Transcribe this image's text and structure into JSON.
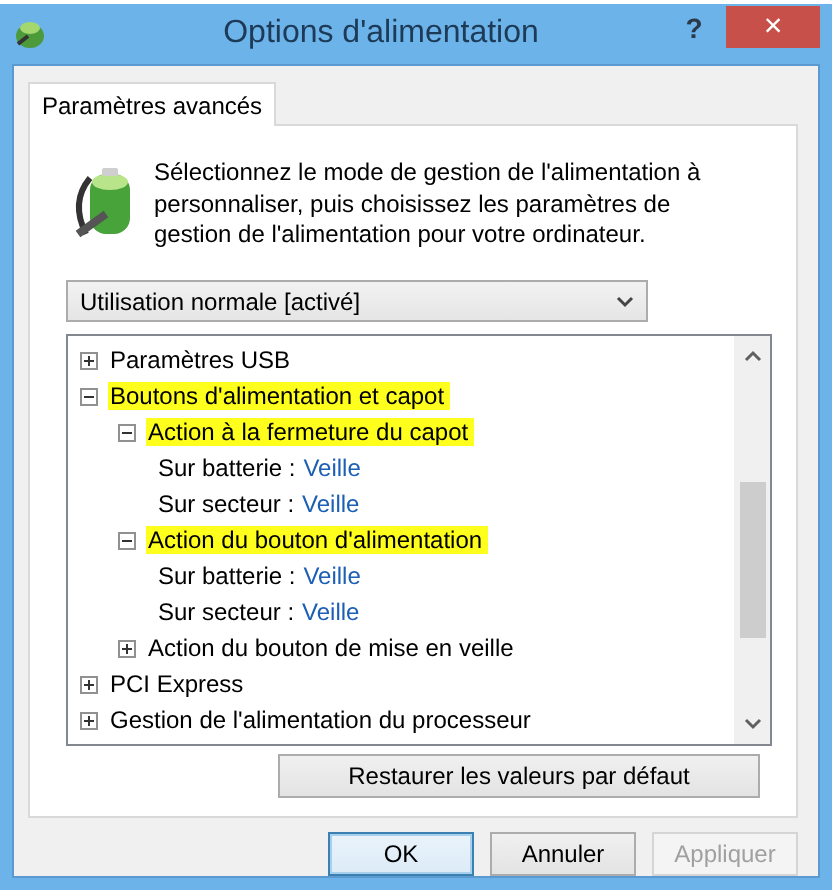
{
  "window": {
    "title": "Options d'alimentation",
    "help": "?",
    "close": "×"
  },
  "tabs": [
    {
      "label": "Paramètres avancés",
      "selected": true
    }
  ],
  "description": "Sélectionnez le mode de gestion de l'alimentation à personnaliser, puis choisissez les paramètres de gestion de l'alimentation pour votre ordinateur.",
  "plan_dropdown": {
    "value": "Utilisation normale [activé]"
  },
  "tree": [
    {
      "kind": "group",
      "label": "Paramètres USB",
      "expanded": false,
      "highlighted": false
    },
    {
      "kind": "group",
      "label": "Boutons d'alimentation et capot",
      "expanded": true,
      "highlighted": true,
      "children": [
        {
          "kind": "group",
          "label": "Action à la fermeture du capot",
          "expanded": true,
          "highlighted": true,
          "children": [
            {
              "kind": "setting",
              "label": "Sur batterie :",
              "value": "Veille"
            },
            {
              "kind": "setting",
              "label": "Sur secteur :",
              "value": "Veille"
            }
          ]
        },
        {
          "kind": "group",
          "label": "Action du bouton d'alimentation",
          "expanded": true,
          "highlighted": true,
          "children": [
            {
              "kind": "setting",
              "label": "Sur batterie :",
              "value": "Veille"
            },
            {
              "kind": "setting",
              "label": "Sur secteur :",
              "value": "Veille"
            }
          ]
        },
        {
          "kind": "group",
          "label": "Action du bouton de mise en veille",
          "expanded": false,
          "highlighted": false
        }
      ]
    },
    {
      "kind": "group",
      "label": "PCI Express",
      "expanded": false,
      "highlighted": false
    },
    {
      "kind": "group",
      "label": "Gestion de l'alimentation du processeur",
      "expanded": false,
      "highlighted": false
    }
  ],
  "restore_button": {
    "label": "Restaurer les valeurs par défaut",
    "disabled": false,
    "default": false
  },
  "buttons": [
    {
      "label": "OK",
      "disabled": false,
      "default": true
    },
    {
      "label": "Annuler",
      "disabled": false,
      "default": false
    },
    {
      "label": "Appliquer",
      "disabled": true,
      "default": false
    }
  ]
}
